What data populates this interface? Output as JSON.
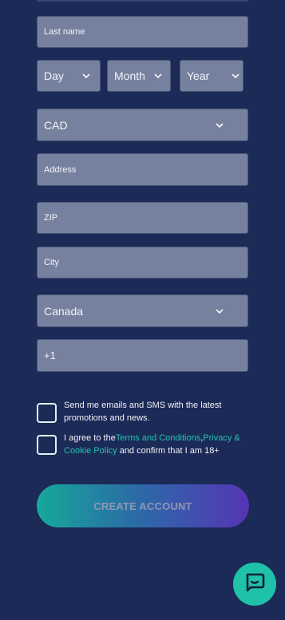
{
  "form": {
    "last_name_placeholder": "Last name",
    "dob": {
      "day": "Day",
      "month": "Month",
      "year": "Year"
    },
    "currency": "CAD",
    "address_placeholder": "Address",
    "zip_placeholder": "ZIP",
    "city_placeholder": "City",
    "country": "Canada",
    "phone_prefix": "+1"
  },
  "consent": {
    "marketing": "Send me emails and SMS with the latest promotions and news.",
    "terms_prefix": "I agree to the",
    "terms_link": "Terms and Conditions",
    "comma": ",",
    "privacy_link": "Privacy & Cookie Policy",
    "terms_suffix": " and confirm that I am 18+"
  },
  "buttons": {
    "create_account": "CREATE ACCOUNT"
  },
  "icons": {
    "chevron": "chevron-down-icon",
    "chat": "chat-bubble-icon"
  },
  "colors": {
    "background": "#1b2a56",
    "field": "#76819f",
    "link": "#25c3b6",
    "chat": "#1fc2a9"
  }
}
